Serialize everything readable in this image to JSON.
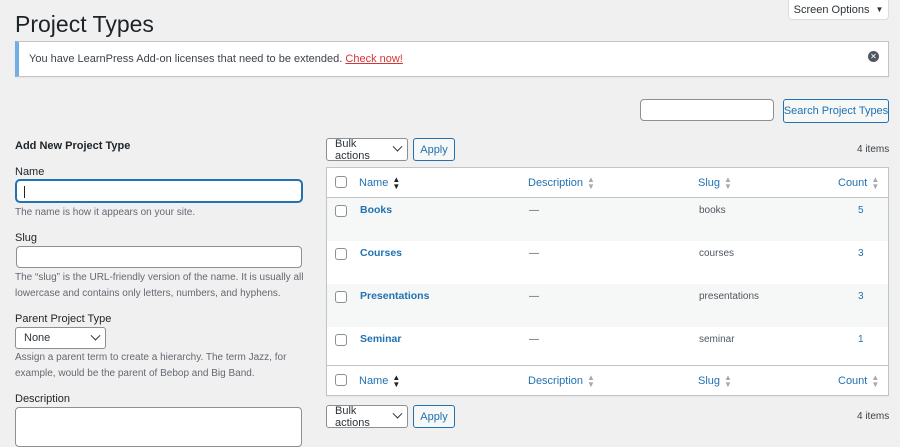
{
  "header": {
    "title": "Project Types",
    "screen_options": "Screen Options"
  },
  "notice": {
    "text": "You have LearnPress Add-on licenses that need to be extended.",
    "link": "Check now!"
  },
  "search": {
    "value": "",
    "button": "Search Project Types"
  },
  "form": {
    "title": "Add New Project Type",
    "name_label": "Name",
    "name_value": "",
    "name_help": "The name is how it appears on your site.",
    "slug_label": "Slug",
    "slug_value": "",
    "slug_help_1": "The “slug” is the URL-friendly version of the name. It is usually all",
    "slug_help_2": "lowercase and contains only letters, numbers, and hyphens.",
    "parent_label": "Parent Project Type",
    "parent_value": "None",
    "parent_help_1": "Assign a parent term to create a hierarchy. The term Jazz, for",
    "parent_help_2": "example, would be the parent of Bebop and Big Band.",
    "description_label": "Description"
  },
  "tablenav": {
    "bulk_label": "Bulk actions",
    "apply_label": "Apply",
    "items_count": "4 items"
  },
  "table": {
    "columns": {
      "name": "Name",
      "description": "Description",
      "slug": "Slug",
      "count": "Count"
    },
    "rows": [
      {
        "name": "Books",
        "description": "—",
        "slug": "books",
        "count": "5"
      },
      {
        "name": "Courses",
        "description": "—",
        "slug": "courses",
        "count": "3"
      },
      {
        "name": "Presentations",
        "description": "—",
        "slug": "presentations",
        "count": "3"
      },
      {
        "name": "Seminar",
        "description": "—",
        "slug": "seminar",
        "count": "1"
      }
    ]
  },
  "colors": {
    "accent": "#2271b1",
    "notice_border": "#72aee6",
    "link_red": "#d63638"
  }
}
